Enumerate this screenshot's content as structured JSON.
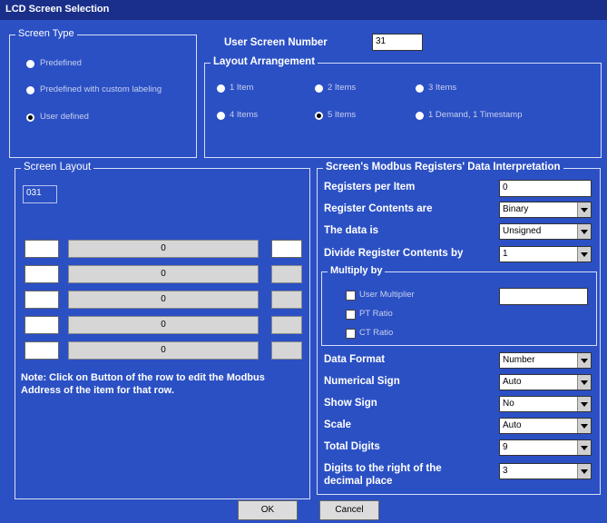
{
  "window": {
    "title": "LCD Screen Selection"
  },
  "screen_type": {
    "title": "Screen Type",
    "options": [
      "Predefined",
      "Predefined with custom labeling",
      "User defined"
    ],
    "selected": "User defined"
  },
  "user_screen_number": {
    "label": "User Screen Number",
    "value": "31"
  },
  "layout_arrangement": {
    "title": "Layout Arrangement",
    "options": [
      "1 Item",
      "2 Items",
      "3 Items",
      "4 Items",
      "5 Items",
      "1 Demand, 1 Timestamp"
    ],
    "selected": "5 Items"
  },
  "screen_layout": {
    "title": "Screen Layout",
    "screen_id": "031",
    "rows": [
      {
        "button": "0"
      },
      {
        "button": "0"
      },
      {
        "button": "0"
      },
      {
        "button": "0"
      },
      {
        "button": "0"
      }
    ],
    "note": "Note: Click on Button  of the row to edit the Modbus Address of the item for that row."
  },
  "interpretation": {
    "title": "Screen's Modbus Registers' Data Interpretation",
    "registers_per_item": {
      "label": "Registers per Item",
      "value": "0"
    },
    "register_contents": {
      "label": "Register Contents are",
      "value": "Binary"
    },
    "data_is": {
      "label": "The data is",
      "value": "Unsigned"
    },
    "divide_by": {
      "label": "Divide Register Contents by",
      "value": "1"
    },
    "multiply_by": {
      "title": "Multiply by",
      "options": [
        "User Multiplier",
        "PT Ratio",
        "CT Ratio"
      ],
      "value": ""
    },
    "data_format": {
      "label": "Data Format",
      "value": "Number"
    },
    "numerical_sign": {
      "label": "Numerical Sign",
      "value": "Auto"
    },
    "show_sign": {
      "label": "Show Sign",
      "value": "No"
    },
    "scale": {
      "label": "Scale",
      "value": "Auto"
    },
    "total_digits": {
      "label": "Total Digits",
      "value": "9"
    },
    "digits_right": {
      "label_line1": "Digits to the right of the",
      "label_line2": "decimal place",
      "value": "3"
    }
  },
  "buttons": {
    "ok": "OK",
    "cancel": "Cancel"
  },
  "colors": {
    "background": "#2b50c4",
    "titlebar": "#1a2f8a"
  }
}
